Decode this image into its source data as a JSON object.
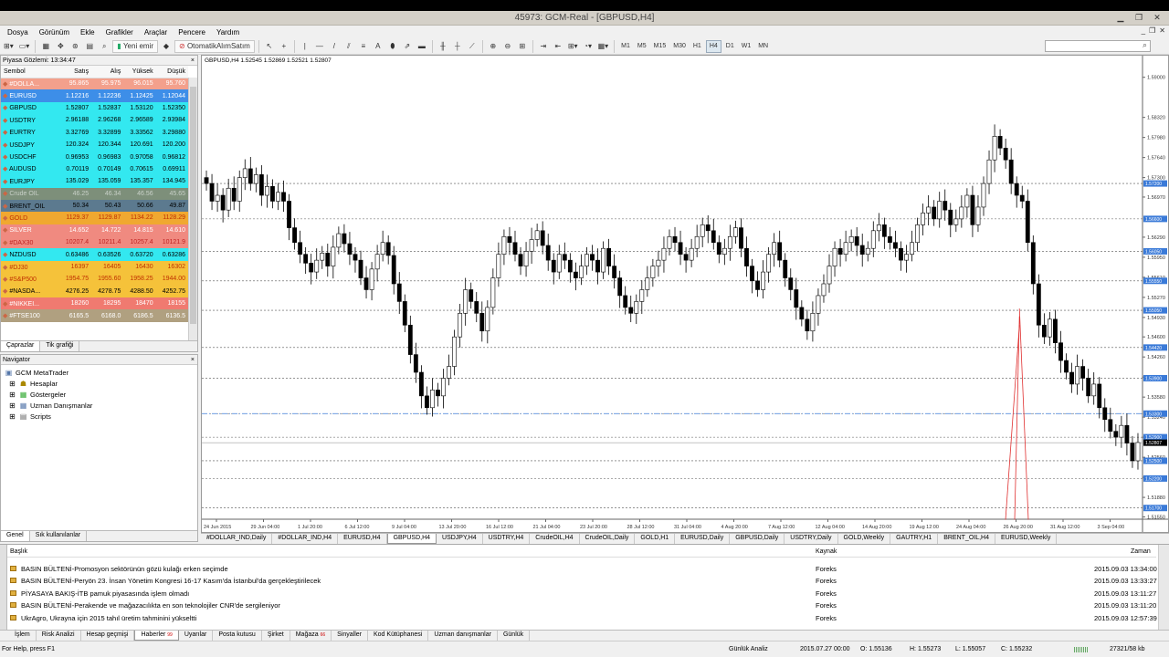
{
  "window": {
    "title": "45973: GCM-Real - [GBPUSD,H4]"
  },
  "menu": [
    "Dosya",
    "Görünüm",
    "Ekle",
    "Grafikler",
    "Araçlar",
    "Pencere",
    "Yardım"
  ],
  "toolbar": {
    "new_order": "Yeni emir",
    "auto_trading": "OtomatikAlımSatım",
    "timeframes": [
      "M1",
      "M5",
      "M15",
      "M30",
      "H1",
      "H4",
      "D1",
      "W1",
      "MN"
    ],
    "active_timeframe": "H4",
    "search_placeholder": ""
  },
  "market_watch": {
    "title": "Piyasa Gözlemi: 13:34:47",
    "columns": [
      "Sembol",
      "Satış",
      "Alış",
      "Yüksek",
      "Düşük"
    ],
    "rows": [
      {
        "symbol": "#DOLLA...",
        "bid": "95.865",
        "ask": "95.975",
        "high": "96.015",
        "low": "95.760",
        "bg": "#f3a08c",
        "fg": "#ffffff"
      },
      {
        "symbol": "EURUSD",
        "bid": "1.12216",
        "ask": "1.12236",
        "high": "1.12425",
        "low": "1.12044",
        "bg": "#3d8ee8",
        "fg": "#ffffff"
      },
      {
        "symbol": "GBPUSD",
        "bid": "1.52807",
        "ask": "1.52837",
        "high": "1.53120",
        "low": "1.52350",
        "bg": "#33e8f0",
        "fg": "#000000"
      },
      {
        "symbol": "USDTRY",
        "bid": "2.96188",
        "ask": "2.96268",
        "high": "2.96589",
        "low": "2.93984",
        "bg": "#33e8f0",
        "fg": "#000000"
      },
      {
        "symbol": "EURTRY",
        "bid": "3.32769",
        "ask": "3.32899",
        "high": "3.33562",
        "low": "3.29880",
        "bg": "#33e8f0",
        "fg": "#000000"
      },
      {
        "symbol": "USDJPY",
        "bid": "120.324",
        "ask": "120.344",
        "high": "120.691",
        "low": "120.200",
        "bg": "#33e8f0",
        "fg": "#000000"
      },
      {
        "symbol": "USDCHF",
        "bid": "0.96953",
        "ask": "0.96983",
        "high": "0.97058",
        "low": "0.96812",
        "bg": "#33e8f0",
        "fg": "#000000"
      },
      {
        "symbol": "AUDUSD",
        "bid": "0.70119",
        "ask": "0.70149",
        "high": "0.70615",
        "low": "0.69911",
        "bg": "#33e8f0",
        "fg": "#000000"
      },
      {
        "symbol": "EURJPY",
        "bid": "135.029",
        "ask": "135.059",
        "high": "135.357",
        "low": "134.945",
        "bg": "#33e8f0",
        "fg": "#000000"
      },
      {
        "symbol": "Crude OIL",
        "bid": "46.25",
        "ask": "46.34",
        "high": "46.56",
        "low": "45.65",
        "bg": "#7d8f7a",
        "fg": "#c8d0c8"
      },
      {
        "symbol": "BRENT_OIL",
        "bid": "50.34",
        "ask": "50.43",
        "high": "50.66",
        "low": "49.87",
        "bg": "#5c7a8f",
        "fg": "#000000"
      },
      {
        "symbol": "GOLD",
        "bid": "1129.37",
        "ask": "1129.87",
        "high": "1134.22",
        "low": "1128.29",
        "bg": "#f0a830",
        "fg": "#c03000"
      },
      {
        "symbol": "SILVER",
        "bid": "14.652",
        "ask": "14.722",
        "high": "14.815",
        "low": "14.610",
        "bg": "#f08a80",
        "fg": "#ffffff"
      },
      {
        "symbol": "#DAX30",
        "bid": "10207.4",
        "ask": "10211.4",
        "high": "10257.4",
        "low": "10121.9",
        "bg": "#f08a80",
        "fg": "#c02020"
      },
      {
        "symbol": "NZDUSD",
        "bid": "0.63486",
        "ask": "0.63526",
        "high": "0.63720",
        "low": "0.63286",
        "bg": "#33e8f0",
        "fg": "#000000"
      },
      {
        "symbol": "#DJ30",
        "bid": "16397",
        "ask": "16405",
        "high": "16430",
        "low": "16302",
        "bg": "#f5c23a",
        "fg": "#c03000"
      },
      {
        "symbol": "#S&P500",
        "bid": "1954.75",
        "ask": "1955.60",
        "high": "1958.25",
        "low": "1944.00",
        "bg": "#f5c23a",
        "fg": "#c03000"
      },
      {
        "symbol": "#NASDA...",
        "bid": "4276.25",
        "ask": "4278.75",
        "high": "4288.50",
        "low": "4252.75",
        "bg": "#f5c23a",
        "fg": "#000000"
      },
      {
        "symbol": "#NIKKEI...",
        "bid": "18260",
        "ask": "18295",
        "high": "18470",
        "low": "18155",
        "bg": "#f07a70",
        "fg": "#ffffff"
      },
      {
        "symbol": "#FTSE100",
        "bid": "6165.5",
        "ask": "6168.0",
        "high": "6186.5",
        "low": "6136.5",
        "bg": "#b0a080",
        "fg": "#ffffff"
      }
    ],
    "tabs": [
      "Çaprazlar",
      "Tik grafiği"
    ]
  },
  "navigator": {
    "title": "Navigator",
    "root": "GCM MetaTrader",
    "items": [
      "Hesaplar",
      "Göstergeler",
      "Uzman Danışmanlar",
      "Scripts"
    ],
    "tabs": [
      "Genel",
      "Sık kullanılanlar"
    ]
  },
  "chart_data": {
    "type": "candlestick",
    "title": "GBPUSD,H4",
    "ohlc_label": "1.52545 1.52869 1.52521 1.52807",
    "x_ticks": [
      "24 Jun 2015",
      "29 Jun 04:00",
      "1 Jul 20:00",
      "6 Jul 12:00",
      "9 Jul 04:00",
      "13 Jul 20:00",
      "16 Jul 12:00",
      "21 Jul 04:00",
      "23 Jul 20:00",
      "28 Jul 12:00",
      "31 Jul 04:00",
      "4 Aug 20:00",
      "7 Aug 12:00",
      "12 Aug 04:00",
      "14 Aug 20:00",
      "19 Aug 12:00",
      "24 Aug 04:00",
      "26 Aug 20:00",
      "31 Aug 12:00",
      "3 Sep 04:00"
    ],
    "y_ticks": [
      "1.59000",
      "1.58320",
      "1.57980",
      "1.57640",
      "1.57300",
      "1.56970",
      "1.56290",
      "1.55950",
      "1.55610",
      "1.55270",
      "1.54930",
      "1.54600",
      "1.54260",
      "1.53920",
      "1.53580",
      "1.53240",
      "1.52900",
      "1.52560",
      "1.52220",
      "1.51880",
      "1.51550"
    ],
    "y_range": [
      1.5151,
      1.5915
    ],
    "price_labels": [
      "1.57200",
      "1.56600",
      "1.56050",
      "1.55550",
      "1.55050",
      "1.54420",
      "1.53900",
      "1.53300",
      "1.52900",
      "1.52807",
      "1.52500",
      "1.52200",
      "1.51700"
    ],
    "closes": [
      1.572,
      1.569,
      1.57,
      1.5675,
      1.5712,
      1.569,
      1.573,
      1.5745,
      1.572,
      1.5735,
      1.57,
      1.5715,
      1.569,
      1.5705,
      1.569,
      1.5645,
      1.562,
      1.56,
      1.5585,
      1.557,
      1.559,
      1.5602,
      1.558,
      1.5612,
      1.5635,
      1.5618,
      1.56,
      1.559,
      1.556,
      1.554,
      1.5575,
      1.56,
      1.562,
      1.5598,
      1.555,
      1.552,
      1.548,
      1.543,
      1.54,
      1.536,
      1.534,
      1.537,
      1.536,
      1.539,
      1.541,
      1.546,
      1.55,
      1.554,
      1.552,
      1.55,
      1.547,
      1.551,
      1.556,
      1.56,
      1.563,
      1.562,
      1.56,
      1.558,
      1.5605,
      1.5625,
      1.564,
      1.5615,
      1.559,
      1.557,
      1.56,
      1.559,
      1.557,
      1.556,
      1.558,
      1.56,
      1.559,
      1.557,
      1.561,
      1.558,
      1.556,
      1.553,
      1.551,
      1.55,
      1.552,
      1.554,
      1.556,
      1.558,
      1.559,
      1.561,
      1.563,
      1.562,
      1.56,
      1.559,
      1.561,
      1.563,
      1.565,
      1.564,
      1.562,
      1.56,
      1.561,
      1.563,
      1.5645,
      1.561,
      1.558,
      1.5555,
      1.554,
      1.557,
      1.56,
      1.562,
      1.559,
      1.556,
      1.554,
      1.551,
      1.549,
      1.547,
      1.55,
      1.553,
      1.555,
      1.558,
      1.561,
      1.56,
      1.562,
      1.563,
      1.5615,
      1.56,
      1.561,
      1.564,
      1.565,
      1.563,
      1.562,
      1.561,
      1.559,
      1.56,
      1.562,
      1.565,
      1.567,
      1.568,
      1.566,
      1.569,
      1.5675,
      1.565,
      1.566,
      1.568,
      1.57,
      1.565,
      1.568,
      1.572,
      1.576,
      1.58,
      1.578,
      1.576,
      1.572,
      1.57,
      1.569,
      1.562,
      1.555,
      1.548,
      1.546,
      1.549,
      1.545,
      1.542,
      1.54,
      1.538,
      1.541,
      1.539,
      1.536,
      1.538,
      1.534,
      1.532,
      1.53,
      1.529,
      1.531,
      1.528,
      1.525,
      1.5281
    ]
  },
  "chart_tabs": [
    "#DOLLAR_IND,Daily",
    "#DOLLAR_IND,H4",
    "EURUSD,H4",
    "GBPUSD,H4",
    "USDJPY,H4",
    "USDTRY,H4",
    "CrudeOIL,H4",
    "CrudeOIL,Daily",
    "GOLD,H1",
    "EURUSD,Daily",
    "GBPUSD,Daily",
    "USDTRY,Daily",
    "GOLD,Weekly",
    "GAUTRY,H1",
    "BRENT_OIL,H4",
    "EURUSD,Weekly"
  ],
  "active_chart_tab": "GBPUSD,H4",
  "news": {
    "columns": [
      "Başlık",
      "Kaynak",
      "Zaman"
    ],
    "rows": [
      {
        "title": "BASIN BÜLTENİ-Promosyon sektörünün gözü kulağı erken seçimde",
        "source": "Foreks",
        "time": "2015.09.03 13:34:00"
      },
      {
        "title": "BASIN BÜLTENİ-Peryön 23. İnsan Yönetim Kongresi 16-17 Kasım'da İstanbul'da gerçekleştirilecek",
        "source": "Foreks",
        "time": "2015.09.03 13:33:27"
      },
      {
        "title": "PİYASAYA BAKIŞ-İTB pamuk piyasasında işlem olmadı",
        "source": "Foreks",
        "time": "2015.09.03 13:11:27"
      },
      {
        "title": "BASIN BÜLTENİ-Perakende ve mağazacılıkta en son teknolojiler CNR'de sergileniyor",
        "source": "Foreks",
        "time": "2015.09.03 13:11:20"
      },
      {
        "title": "UkrAgro, Ukrayna için 2015 tahıl üretim tahminini yükseltti",
        "source": "Foreks",
        "time": "2015.09.03 12:57:39"
      }
    ]
  },
  "terminal_tabs": [
    {
      "label": "İşlem",
      "badge": ""
    },
    {
      "label": "Risk Analizi",
      "badge": ""
    },
    {
      "label": "Hesap geçmişi",
      "badge": ""
    },
    {
      "label": "Haberler",
      "badge": "99"
    },
    {
      "label": "Uyarılar",
      "badge": ""
    },
    {
      "label": "Posta kutusu",
      "badge": ""
    },
    {
      "label": "Şirket",
      "badge": ""
    },
    {
      "label": "Mağaza",
      "badge": "66"
    },
    {
      "label": "Sinyaller",
      "badge": ""
    },
    {
      "label": "Kod Kütüphanesi",
      "badge": ""
    },
    {
      "label": "Uzman danışmanlar",
      "badge": ""
    },
    {
      "label": "Günlük",
      "badge": ""
    }
  ],
  "active_terminal_tab": "Haberler",
  "terminal_side_label": "Terminal",
  "status": {
    "help": "For Help, press F1",
    "profile": "Günlük Analiz",
    "datetime": "2015.07.27 00:00",
    "open": "O: 1.55136",
    "high": "H: 1.55273",
    "low": "L: 1.55057",
    "close": "C: 1.55232",
    "traffic": "27321/58 kb"
  }
}
